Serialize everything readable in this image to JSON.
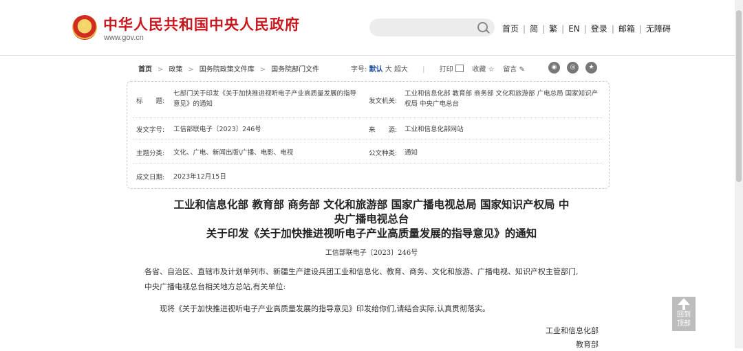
{
  "header": {
    "site_title": "中华人民共和国中央人民政府",
    "domain": "www.gov.cn",
    "search_placeholder": "",
    "nav": [
      "首页",
      "简",
      "繁",
      "EN",
      "登录",
      "邮箱",
      "无障碍"
    ]
  },
  "breadcrumb": [
    "首页",
    "政策",
    "国务院政策文件库",
    "国务院部门文件"
  ],
  "tools": {
    "font_label": "字号:",
    "font_default": "默认",
    "font_large": "大",
    "font_xlarge": "超大",
    "print": "打印",
    "favorite": "收藏",
    "comment": "留言"
  },
  "social_icons": [
    "weibo-icon",
    "wechat-icon",
    "star-icon"
  ],
  "info": {
    "title_label": "标　　题:",
    "title_value": "七部门关于印发《关于加快推进视听电子产业高质量发展的指导意见》的通知",
    "issuer_label": "发文机关:",
    "issuer_value": "工业和信息化部 教育部 商务部 文化和旅游部 广电总局 国家知识产权局 中央广电总台",
    "docno_label": "发文字号:",
    "docno_value": "工信部联电子〔2023〕246号",
    "source_label": "来　　源:",
    "source_value": "工业和信息化部网站",
    "topic_label": "主题分类:",
    "topic_value": "文化、广电、新闻出版\\广播、电影、电视",
    "type_label": "公文种类:",
    "type_value": "通知",
    "date_label": "成文日期:",
    "date_value": "2023年12月15日"
  },
  "article": {
    "title_line1": "工业和信息化部 教育部 商务部 文化和旅游部 国家广播电视总局 国家知识产权局 中",
    "title_line2": "央广播电视总台",
    "title_line3": "关于印发《关于加快推进视听电子产业高质量发展的指导意见》的通知",
    "doc_number": "工信部联电子〔2023〕246号",
    "salutation_line1": "各省、自治区、直辖市及计划单列市、新疆生产建设兵团工业和信息化、教育、商务、文化和旅游、广播电视、知识产权主管部门,",
    "salutation_line2": "中央广播电视总台相关地方总站,有关单位:",
    "paragraph": "现将《关于加快推进视听电子产业高质量发展的指导意见》印发给你们,请结合实际,认真贯彻落实。",
    "signatory1": "工业和信息化部",
    "signatory2": "教育部"
  },
  "back_to_top": {
    "line1": "回到",
    "line2": "顶部"
  }
}
